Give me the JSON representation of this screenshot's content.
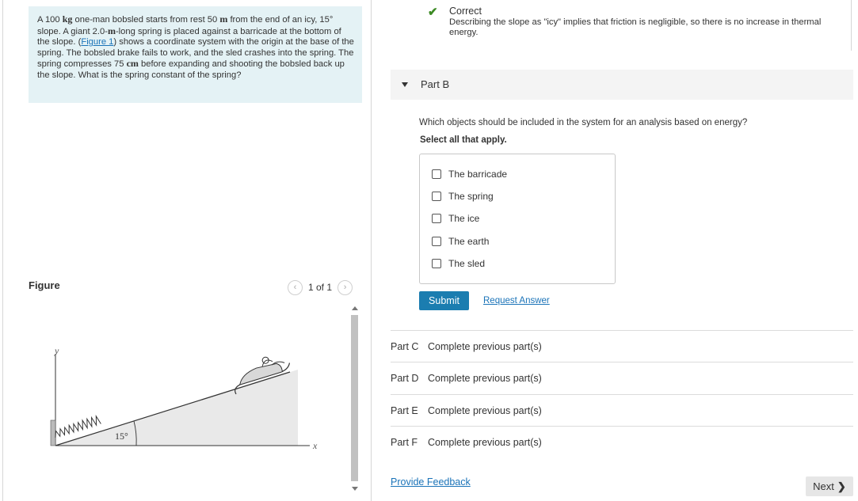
{
  "problem": {
    "text_1": "A 100 ",
    "mass_unit_value": "kg",
    "text_2": " one-man bobsled starts from rest 50 ",
    "dist_unit": "m",
    "text_3": " from the end of an icy, 15° slope. A giant 2.0-",
    "spring_unit": "m",
    "text_4": "-long spring is placed against a barricade at the bottom of the slope. (",
    "figure_link": "Figure 1",
    "text_5": ") shows a coordinate system with the origin at the base of the spring. The bobsled brake fails to work, and the sled crashes into the spring. The spring compresses 75 ",
    "compress_unit": "cm",
    "text_6": " before expanding and shooting the bobsled back up the slope. What is the spring constant of the spring?"
  },
  "figure": {
    "title": "Figure",
    "pager_text": "1 of 1",
    "y_axis": "y",
    "x_axis": "x",
    "angle_label": "15°"
  },
  "feedback": {
    "status": "Correct",
    "message": "Describing the slope as \"icy\" implies that friction is negligible, so there is no increase in thermal energy."
  },
  "part_b": {
    "label": "Part B",
    "question": "Which objects should be included in the system for an analysis based on energy?",
    "instruction": "Select all that apply.",
    "choices": [
      "The barricade",
      "The spring",
      "The ice",
      "The earth",
      "The sled"
    ],
    "submit_label": "Submit",
    "request_label": "Request Answer"
  },
  "other_parts": [
    {
      "label": "Part C",
      "status": "Complete previous part(s)"
    },
    {
      "label": "Part D",
      "status": "Complete previous part(s)"
    },
    {
      "label": "Part E",
      "status": "Complete previous part(s)"
    },
    {
      "label": "Part F",
      "status": "Complete previous part(s)"
    }
  ],
  "footer": {
    "feedback_link": "Provide Feedback",
    "next_label": "Next"
  }
}
